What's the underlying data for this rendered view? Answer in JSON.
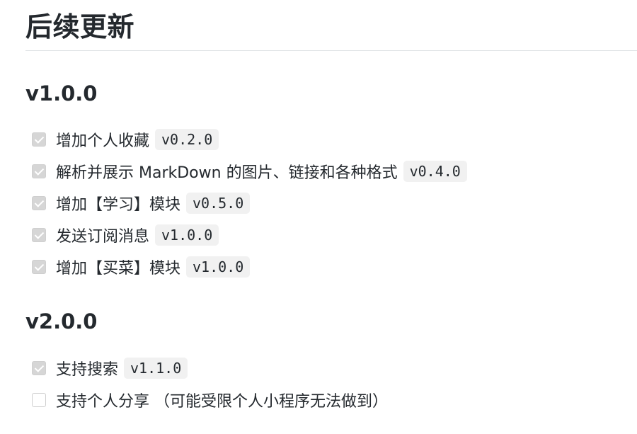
{
  "page": {
    "title": "后续更新"
  },
  "sections": [
    {
      "version": "v1.0.0",
      "items": [
        {
          "text": "增加个人收藏",
          "tag": "v0.2.0",
          "checked": true
        },
        {
          "text": "解析并展示 MarkDown 的图片、链接和各种格式",
          "tag": "v0.4.0",
          "checked": true
        },
        {
          "text": "增加【学习】模块",
          "tag": "v0.5.0",
          "checked": true
        },
        {
          "text": "发送订阅消息",
          "tag": "v1.0.0",
          "checked": true
        },
        {
          "text": "增加【买菜】模块",
          "tag": "v1.0.0",
          "checked": true
        }
      ]
    },
    {
      "version": "v2.0.0",
      "items": [
        {
          "text": "支持搜索",
          "tag": "v1.1.0",
          "checked": true
        },
        {
          "text": "支持个人分享 （可能受限个人小程序无法做到）",
          "checked": false
        }
      ]
    }
  ]
}
